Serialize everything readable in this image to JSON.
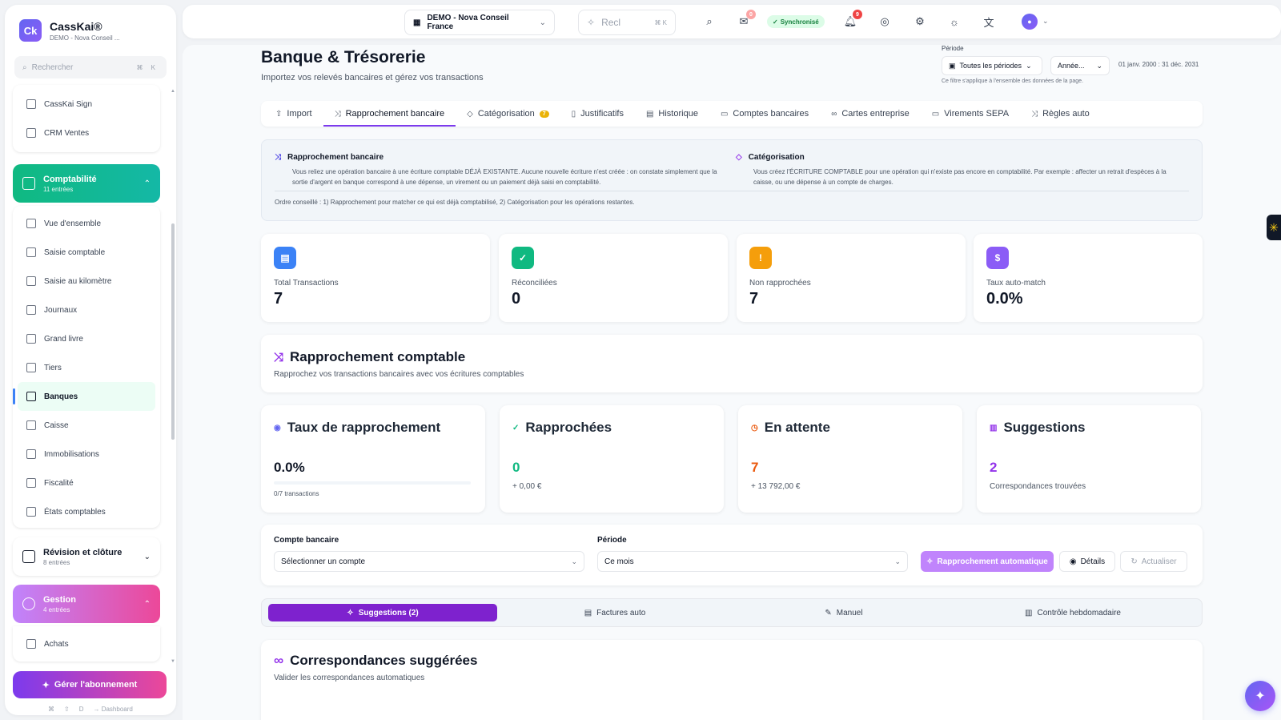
{
  "brand": {
    "name": "CassKai®",
    "subtitle": "DEMO - Nova Conseil ...",
    "logo": "Ck"
  },
  "sidebar": {
    "search_placeholder": "Rechercher",
    "search_kbd": "⌘ K",
    "top_items": [
      {
        "label": "CassKai Sign",
        "icon": "signature-icon"
      },
      {
        "label": "CRM Ventes",
        "icon": "handshake-icon"
      }
    ],
    "comptabilite": {
      "title": "Comptabilité",
      "subtitle": "11 entrées",
      "items": [
        {
          "label": "Vue d'ensemble"
        },
        {
          "label": "Saisie comptable"
        },
        {
          "label": "Saisie au kilomètre"
        },
        {
          "label": "Journaux"
        },
        {
          "label": "Grand livre"
        },
        {
          "label": "Tiers"
        },
        {
          "label": "Banques",
          "active": true
        },
        {
          "label": "Caisse"
        },
        {
          "label": "Immobilisations"
        },
        {
          "label": "Fiscalité"
        },
        {
          "label": "États comptables"
        }
      ]
    },
    "revision": {
      "title": "Révision et clôture",
      "subtitle": "8 entrées"
    },
    "gestion": {
      "title": "Gestion",
      "subtitle": "4 entrées",
      "items": [
        {
          "label": "Achats"
        }
      ]
    },
    "subscription_button": "Gérer l'abonnement",
    "footer": {
      "k1": "⌘",
      "k2": "⇧",
      "k3": "D",
      "label": "→ Dashboard"
    }
  },
  "topbar": {
    "company": "DEMO - Nova Conseil France",
    "ai_placeholder": "Recl",
    "ai_kbd": "⌘ K",
    "sync_status": "Synchronisé",
    "inbox_badge": "0",
    "notif_badge": "9"
  },
  "page": {
    "title": "Banque & Trésorerie",
    "subtitle": "Importez vos relevés bancaires et gérez vos transactions",
    "period_label": "Période",
    "period_all": "Toutes les périodes",
    "period_year": "Année...",
    "period_range": "01 janv. 2000 : 31 déc. 2031",
    "period_note": "Ce filtre s'applique à l'ensemble des données de la page."
  },
  "tabs": [
    {
      "label": "Import",
      "icon": "upload-icon"
    },
    {
      "label": "Rapprochement bancaire",
      "icon": "shuffle-icon",
      "active": true
    },
    {
      "label": "Catégorisation",
      "icon": "tag-icon",
      "badge": "7"
    },
    {
      "label": "Justificatifs",
      "icon": "file-icon"
    },
    {
      "label": "Historique",
      "icon": "history-icon"
    },
    {
      "label": "Comptes bancaires",
      "icon": "card-icon"
    },
    {
      "label": "Cartes entreprise",
      "icon": "link-icon"
    },
    {
      "label": "Virements SEPA",
      "icon": "transfer-icon"
    },
    {
      "label": "Règles auto",
      "icon": "shuffle-icon"
    }
  ],
  "info": {
    "left_title": "Rapprochement bancaire",
    "left_text": "Vous reliez une opération bancaire à une écriture comptable DÉJÀ EXISTANTE. Aucune nouvelle écriture n'est créée : on constate simplement que la sortie d'argent en banque correspond à une dépense, un virement ou un paiement déjà saisi en comptabilité.",
    "right_title": "Catégorisation",
    "right_text": "Vous créez l'ÉCRITURE COMPTABLE pour une opération qui n'existe pas encore en comptabilité. Par exemple : affecter un retrait d'espèces à la caisse, ou une dépense à un compte de charges.",
    "footer": "Ordre conseillé : 1) Rapprochement pour matcher ce qui est déjà comptabilisé, 2) Catégorisation pour les opérations restantes."
  },
  "stats": [
    {
      "label": "Total Transactions",
      "value": "7",
      "color": "#3b82f6",
      "icon": "document-icon",
      "glyph": "▤"
    },
    {
      "label": "Réconciliées",
      "value": "0",
      "color": "#10b981",
      "icon": "check-circle-icon",
      "glyph": "✓"
    },
    {
      "label": "Non rapprochées",
      "value": "7",
      "color": "#f59e0b",
      "icon": "alert-circle-icon",
      "glyph": "!"
    },
    {
      "label": "Taux auto-match",
      "value": "0.0%",
      "color": "#8b5cf6",
      "icon": "dollar-icon",
      "glyph": "$"
    }
  ],
  "rapprochement": {
    "title": "Rapprochement comptable",
    "subtitle": "Rapprochez vos transactions bancaires avec vos écritures comptables"
  },
  "kpis": {
    "taux": {
      "title": "Taux de rapprochement",
      "value": "0.0%",
      "progress": 0,
      "bar_label": "0/7 transactions",
      "color": "#6366f1"
    },
    "rapprochees": {
      "title": "Rapprochées",
      "value": "0",
      "sub": "+ 0,00 €",
      "color": "#10b981"
    },
    "attente": {
      "title": "En attente",
      "value": "7",
      "sub": "+ 13 792,00 €",
      "color": "#ea580c"
    },
    "suggestions": {
      "title": "Suggestions",
      "value": "2",
      "sub": "Correspondances trouvées",
      "color": "#9333ea"
    }
  },
  "filters": {
    "account_label": "Compte bancaire",
    "account_value": "Sélectionner un compte",
    "period_label": "Période",
    "period_value": "Ce mois",
    "auto_button": "Rapprochement automatique",
    "details_button": "Détails",
    "refresh_button": "Actualiser"
  },
  "subtabs": [
    {
      "label": "Suggestions (2)",
      "active": true
    },
    {
      "label": "Factures auto"
    },
    {
      "label": "Manuel"
    },
    {
      "label": "Contrôle hebdomadaire"
    }
  ],
  "suggestions_card": {
    "title": "Correspondances suggérées",
    "subtitle": "Valider les correspondances automatiques"
  }
}
